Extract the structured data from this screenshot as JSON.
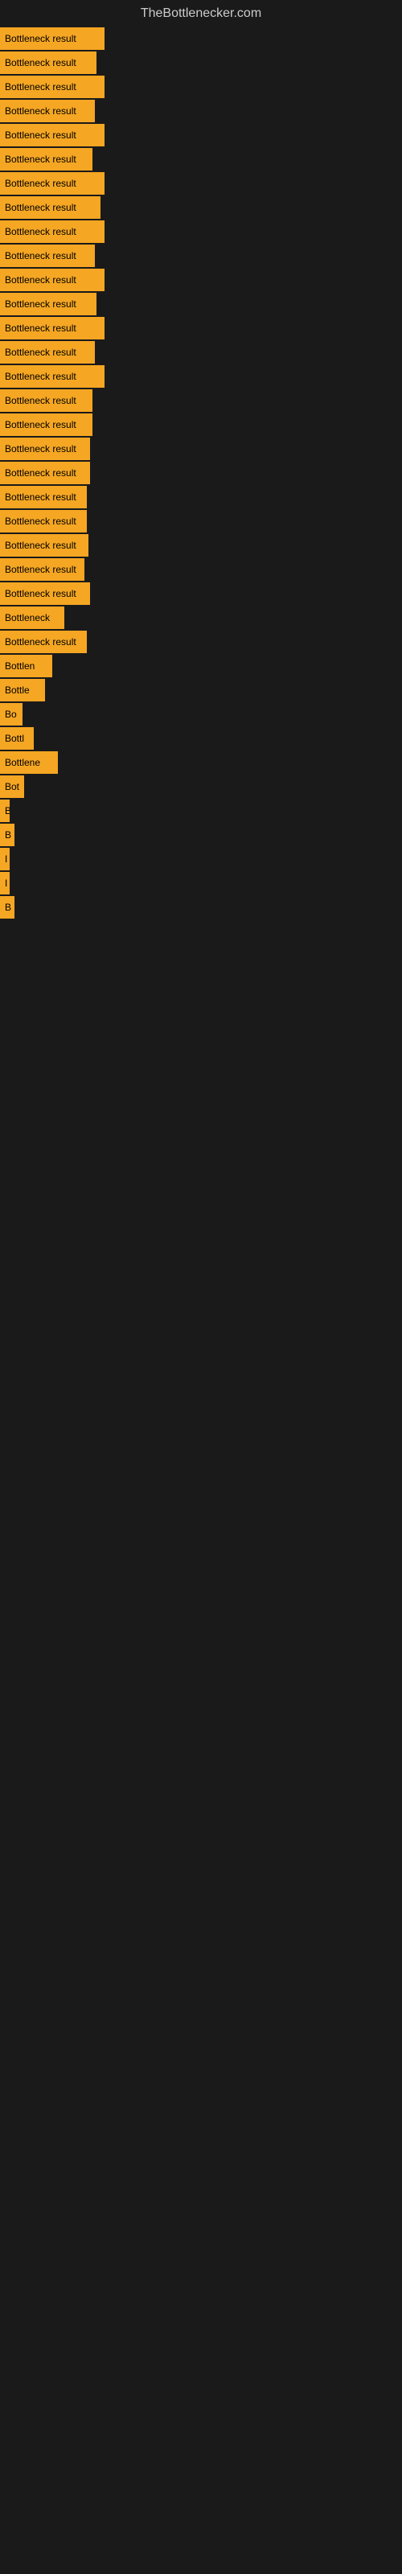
{
  "site": {
    "title": "TheBottlenecker.com"
  },
  "bars": [
    {
      "label": "Bottleneck result",
      "width": 130
    },
    {
      "label": "Bottleneck result",
      "width": 120
    },
    {
      "label": "Bottleneck result",
      "width": 130
    },
    {
      "label": "Bottleneck result",
      "width": 118
    },
    {
      "label": "Bottleneck result",
      "width": 130
    },
    {
      "label": "Bottleneck result",
      "width": 115
    },
    {
      "label": "Bottleneck result",
      "width": 130
    },
    {
      "label": "Bottleneck result",
      "width": 125
    },
    {
      "label": "Bottleneck result",
      "width": 130
    },
    {
      "label": "Bottleneck result",
      "width": 118
    },
    {
      "label": "Bottleneck result",
      "width": 130
    },
    {
      "label": "Bottleneck result",
      "width": 120
    },
    {
      "label": "Bottleneck result",
      "width": 130
    },
    {
      "label": "Bottleneck result",
      "width": 118
    },
    {
      "label": "Bottleneck result",
      "width": 130
    },
    {
      "label": "Bottleneck result",
      "width": 115
    },
    {
      "label": "Bottleneck result",
      "width": 115
    },
    {
      "label": "Bottleneck result",
      "width": 112
    },
    {
      "label": "Bottleneck result",
      "width": 112
    },
    {
      "label": "Bottleneck result",
      "width": 108
    },
    {
      "label": "Bottleneck result",
      "width": 108
    },
    {
      "label": "Bottleneck result",
      "width": 110
    },
    {
      "label": "Bottleneck result",
      "width": 105
    },
    {
      "label": "Bottleneck result",
      "width": 112
    },
    {
      "label": "Bottleneck",
      "width": 80
    },
    {
      "label": "Bottleneck result",
      "width": 108
    },
    {
      "label": "Bottlen",
      "width": 65
    },
    {
      "label": "Bottle",
      "width": 56
    },
    {
      "label": "Bo",
      "width": 28
    },
    {
      "label": "Bottl",
      "width": 42
    },
    {
      "label": "Bottlene",
      "width": 72
    },
    {
      "label": "Bot",
      "width": 30
    },
    {
      "label": "B",
      "width": 12
    },
    {
      "label": "B",
      "width": 18
    },
    {
      "label": "I",
      "width": 8
    },
    {
      "label": "I",
      "width": 6
    },
    {
      "label": "B",
      "width": 18
    }
  ]
}
